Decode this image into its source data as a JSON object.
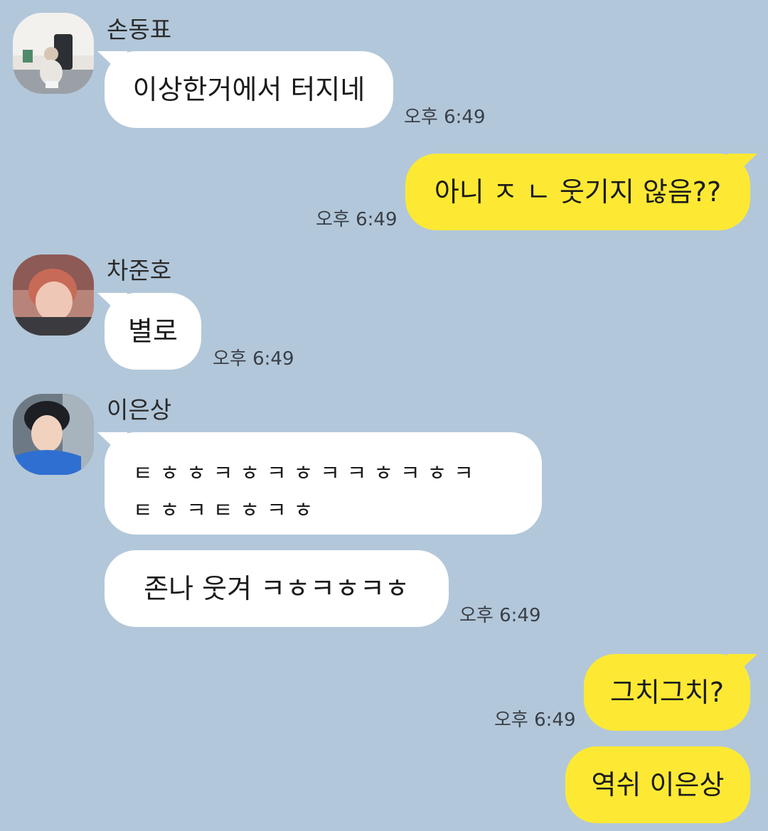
{
  "colors": {
    "background": "#b2c7da",
    "incoming_bubble": "#ffffff",
    "outgoing_bubble": "#fde933"
  },
  "messages": [
    {
      "sender": "손동표",
      "avatar_icon": "profile-photo",
      "text": "이상한거에서 터지네",
      "time": "오후 6:49"
    },
    {
      "direction": "outgoing",
      "text": "아니 ㅈ ㄴ 웃기지 않음??",
      "time": "오후 6:49"
    },
    {
      "sender": "차준호",
      "avatar_icon": "profile-photo",
      "text": "별로",
      "time": "오후 6:49"
    },
    {
      "sender": "이은상",
      "avatar_icon": "profile-photo",
      "lines": [
        "ㅌㅎㅎㅋㅎㅋㅎㅋㅋㅎㅋㅎㅋ",
        "ㅌㅎㅋㅌㅎㅋㅎ"
      ],
      "text2": "존나 웃겨 ㅋㅎㅋㅎㅋㅎ",
      "time": "오후 6:49"
    },
    {
      "direction": "outgoing",
      "text": "그치그치?",
      "time": "오후 6:49"
    },
    {
      "direction": "outgoing",
      "text": "역쉬 이은상"
    }
  ]
}
